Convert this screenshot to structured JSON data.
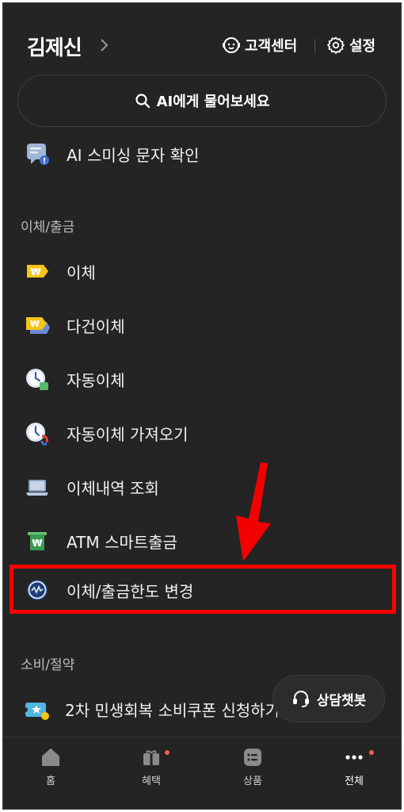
{
  "header": {
    "user_name": "김제신",
    "support_label": "고객센터",
    "settings_label": "설정"
  },
  "search": {
    "label": "AI에게 물어보세요"
  },
  "top_items": [
    {
      "label": "AI 스미싱 문자 확인",
      "icon": "smishing-check-icon"
    }
  ],
  "sections": [
    {
      "title": "이체/출금",
      "items": [
        {
          "label": "이체",
          "icon": "transfer-icon"
        },
        {
          "label": "다건이체",
          "icon": "multi-transfer-icon"
        },
        {
          "label": "자동이체",
          "icon": "auto-transfer-icon"
        },
        {
          "label": "자동이체 가져오기",
          "icon": "import-auto-transfer-icon"
        },
        {
          "label": "이체내역 조회",
          "icon": "laptop-icon"
        },
        {
          "label": "ATM 스마트출금",
          "icon": "atm-icon"
        },
        {
          "label": "이체/출금한도 변경",
          "icon": "limit-gauge-icon",
          "highlighted": true
        }
      ]
    },
    {
      "title": "소비/절약",
      "items": [
        {
          "label": "2차 민생회복 소비쿠폰 신청하기",
          "icon": "coupon-icon"
        }
      ]
    }
  ],
  "chatbot": {
    "label": "상담챗봇"
  },
  "bottom_nav": [
    {
      "label": "홈",
      "icon": "home-icon",
      "badge": false
    },
    {
      "label": "혜택",
      "icon": "gift-icon",
      "badge": true
    },
    {
      "label": "상품",
      "icon": "products-icon",
      "badge": false
    },
    {
      "label": "전체",
      "icon": "more-icon",
      "badge": true,
      "active": true
    }
  ],
  "colors": {
    "background": "#242424",
    "highlight": "#ff0000",
    "transfer_icon": "#f5c518",
    "badge": "#ff5a5a"
  }
}
